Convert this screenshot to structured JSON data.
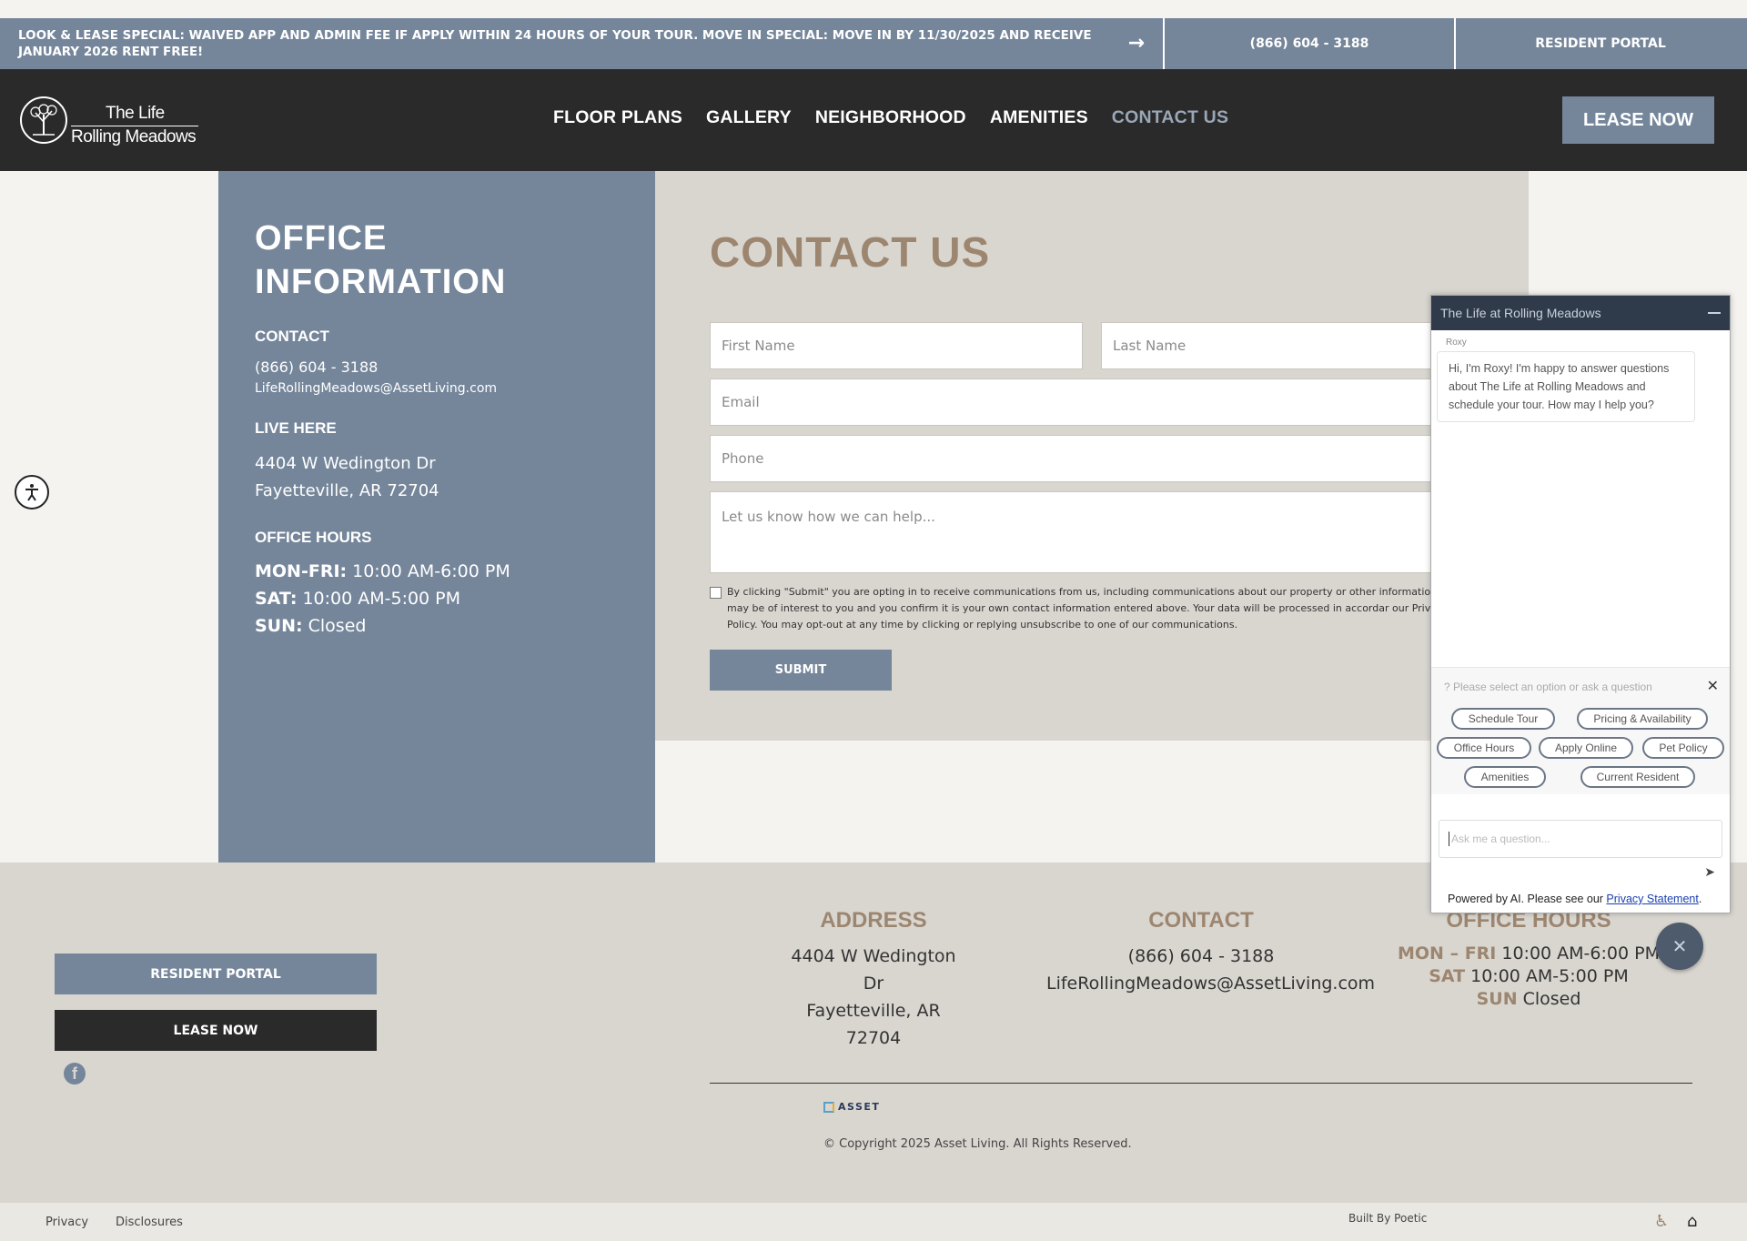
{
  "announcement": {
    "text": "LOOK & LEASE SPECIAL: WAIVED APP AND ADMIN FEE IF APPLY WITHIN 24 HOURS OF YOUR TOUR. MOVE IN SPECIAL: MOVE IN BY 11/30/2025 AND RECEIVE JANUARY 2026 RENT FREE!",
    "arrow_icon": "arrow-right-icon",
    "phone": "(866) 604 - 3188",
    "portal": "RESIDENT PORTAL"
  },
  "nav": {
    "logo_line1": "The Life",
    "logo_line2": "Rolling Meadows",
    "links": [
      "FLOOR PLANS",
      "GALLERY",
      "NEIGHBORHOOD",
      "AMENITIES",
      "CONTACT US"
    ],
    "active": "CONTACT US",
    "lease": "LEASE NOW"
  },
  "office": {
    "title": "OFFICE INFORMATION",
    "contact_heading": "CONTACT",
    "phone": "(866) 604 - 3188",
    "email": "LifeRollingMeadows@AssetLiving.com",
    "live_heading": "LIVE HERE",
    "address1": "4404 W Wedington Dr",
    "address2": "Fayetteville, AR 72704",
    "hours_heading": "OFFICE HOURS",
    "hours": [
      {
        "day": "MON-FRI:",
        "time": "10:00 AM-6:00 PM"
      },
      {
        "day": "SAT:",
        "time": "10:00 AM-5:00 PM"
      },
      {
        "day": "SUN:",
        "time": "Closed"
      }
    ]
  },
  "contact_form": {
    "title": "CONTACT US",
    "first_name": "First Name",
    "last_name": "Last Name",
    "email": "Email",
    "phone": "Phone",
    "message": "Let us know how we can help...",
    "consent": "By clicking \"Submit\" you are opting in to receive communications from us, including communications about our property or other informatio believe may be of interest to you and you confirm it is your own contact information entered above. Your data will be processed in accordar our Privacy Policy. You may opt-out at any time by clicking or replying unsubscribe to one of our communications.",
    "submit": "SUBMIT"
  },
  "footer": {
    "resident_portal": "RESIDENT PORTAL",
    "lease_now": "LEASE NOW",
    "address_heading": "ADDRESS",
    "address1": "4404 W Wedington Dr",
    "address2": "Fayetteville, AR 72704",
    "contact_heading": "CONTACT",
    "phone": "(866) 604 - 3188",
    "email": "LifeRollingMeadows@AssetLiving.com",
    "hours_heading": "OFFICE HOURS",
    "hours": [
      {
        "day": "MON – FRI",
        "time": "10:00 AM-6:00 PM"
      },
      {
        "day": "SAT",
        "time": "10:00 AM-5:00 PM"
      },
      {
        "day": "SUN",
        "time": "Closed"
      }
    ],
    "asset_logo": "ASSET",
    "copyright": "© Copyright 2025 Asset Living. All Rights Reserved."
  },
  "bottom": {
    "privacy": "Privacy",
    "disclosures": "Disclosures",
    "built_by": "Built By Poetic"
  },
  "chat": {
    "title": "The Life at Rolling Meadows",
    "bot_name": "Roxy",
    "message": "Hi, I'm Roxy! I'm happy to answer questions about The Life at Rolling Meadows and schedule your tour. How may I help you?",
    "prompt": "Please select an option or ask a question",
    "options": [
      "Schedule Tour",
      "Pricing & Availability",
      "Office Hours",
      "Apply Online",
      "Pet Policy",
      "Amenities",
      "Current Resident"
    ],
    "input_placeholder": "Ask me a question...",
    "footer_text": "Powered by AI. Please see our ",
    "footer_link": "Privacy Statement",
    "footer_end": "."
  },
  "colors": {
    "slate": "#75869b",
    "dark": "#2a2a2a",
    "tan": "#9c8670",
    "beige": "#d9d6d0"
  }
}
